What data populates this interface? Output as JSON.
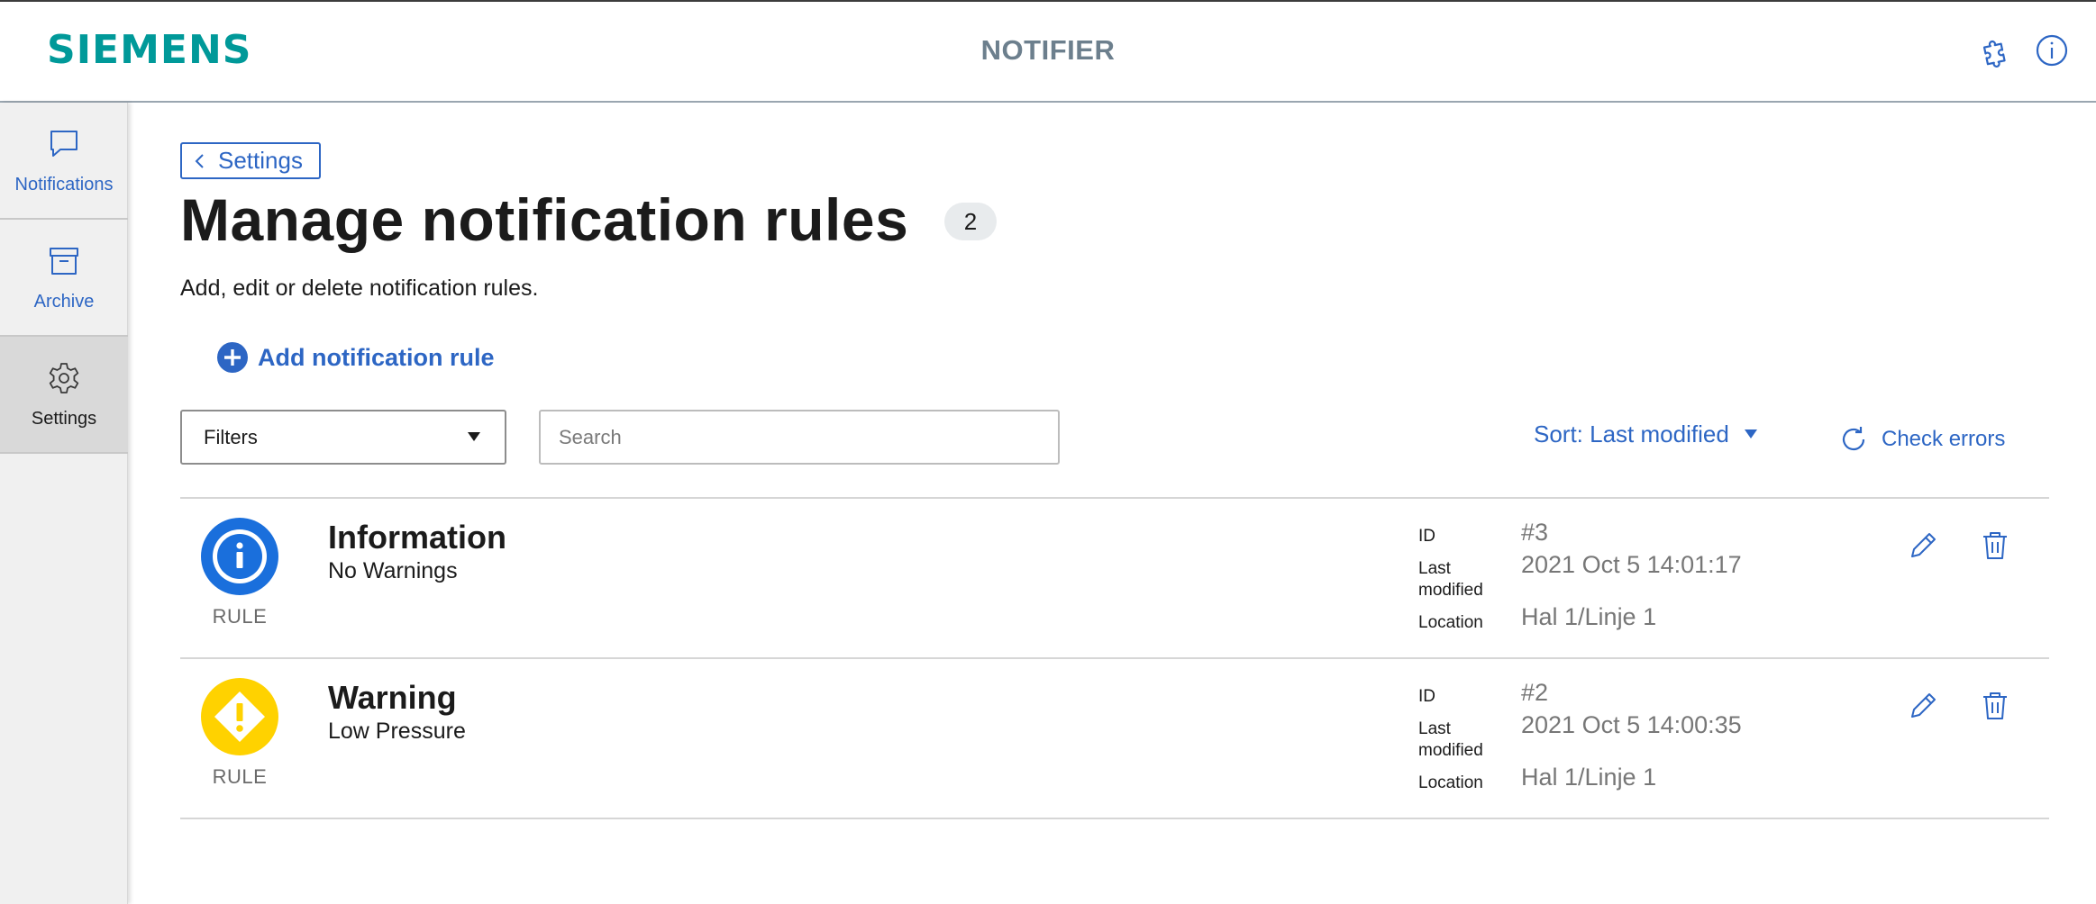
{
  "header": {
    "logo": "SIEMENS",
    "title": "NOTIFIER",
    "icons": [
      "puzzle-icon",
      "info-icon"
    ],
    "brand_color": "#009999"
  },
  "sidebar": {
    "items": [
      {
        "label": "Notifications",
        "icon": "chat-bubble-icon",
        "active": false
      },
      {
        "label": "Archive",
        "icon": "archive-box-icon",
        "active": false
      },
      {
        "label": "Settings",
        "icon": "gear-icon",
        "active": true
      }
    ]
  },
  "main": {
    "back_label": "Settings",
    "title": "Manage notification rules",
    "count": "2",
    "subtitle": "Add, edit or delete notification rules.",
    "add_label": "Add notification rule",
    "filters_label": "Filters",
    "search_placeholder": "Search",
    "sort_label": "Sort: Last modified",
    "check_errors_label": "Check errors",
    "accent_color": "#2d66c4"
  },
  "rules": [
    {
      "icon": "info-icon",
      "icon_color": "#1a6fdc",
      "type_label": "RULE",
      "title": "Information",
      "subtitle": "No Warnings",
      "id_label": "ID",
      "id": "#3",
      "modified_label": "Last modified",
      "modified": "2021 Oct 5 14:01:17",
      "location_label": "Location",
      "location": "Hal 1/Linje 1"
    },
    {
      "icon": "warning-icon",
      "icon_color": "#ffd200",
      "type_label": "RULE",
      "title": "Warning",
      "subtitle": "Low Pressure",
      "id_label": "ID",
      "id": "#2",
      "modified_label": "Last modified",
      "modified": "2021 Oct 5 14:00:35",
      "location_label": "Location",
      "location": "Hal 1/Linje 1"
    }
  ]
}
